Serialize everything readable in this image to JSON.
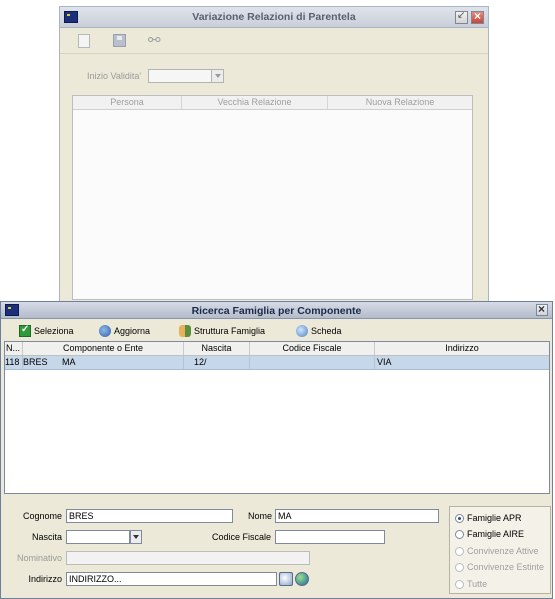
{
  "background_window": {
    "title": "Variazione Relazioni di Parentela",
    "inizio_validita_label": "Inizio Validita'",
    "inizio_validita_value": "",
    "columns": [
      "Persona",
      "Vecchia Relazione",
      "Nuova Relazione"
    ]
  },
  "search_window": {
    "title": "Ricerca Famiglia per Componente",
    "toolbar": {
      "seleziona": "Seleziona",
      "aggiorna": "Aggiorna",
      "struttura_famiglia": "Struttura Famiglia",
      "scheda": "Scheda"
    },
    "grid": {
      "columns": [
        "N...",
        "Componente o Ente",
        "Nascita",
        "Codice Fiscale",
        "Indirizzo"
      ],
      "rows": [
        {
          "n": "118",
          "componente_cognome": "BRES",
          "componente_nome": "MA",
          "nascita": "12/",
          "codice_fiscale": "",
          "indirizzo": "VIA"
        }
      ]
    },
    "form": {
      "cognome_label": "Cognome",
      "cognome_value": "BRES",
      "nome_label": "Nome",
      "nome_value": "MA",
      "nascita_label": "Nascita",
      "nascita_value": "",
      "codice_fiscale_label": "Codice Fiscale",
      "codice_fiscale_value": "",
      "nominativo_label": "Nominativo",
      "nominativo_value": "",
      "indirizzo_label": "Indirizzo",
      "indirizzo_value": "INDIRIZZO..."
    },
    "filter": {
      "options": [
        {
          "label": "Famiglie APR",
          "selected": true,
          "enabled": true
        },
        {
          "label": "Famiglie AIRE",
          "selected": false,
          "enabled": true
        },
        {
          "label": "Convivenze Attive",
          "selected": false,
          "enabled": false
        },
        {
          "label": "Convivenze Estinte",
          "selected": false,
          "enabled": false
        },
        {
          "label": "Tutte",
          "selected": false,
          "enabled": false
        }
      ]
    }
  }
}
